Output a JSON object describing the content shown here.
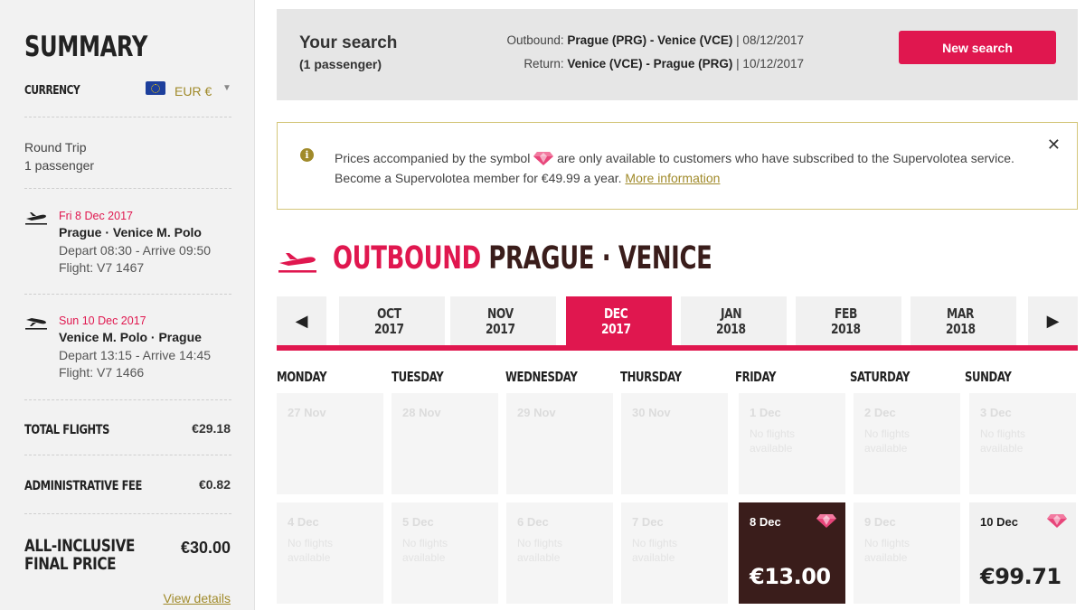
{
  "sidebar": {
    "title": "SUMMARY",
    "currency_label": "CURRENCY",
    "currency_value": "EUR €",
    "trip_type": "Round Trip",
    "passengers": "1 passenger",
    "flights": [
      {
        "date": "Fri 8 Dec 2017",
        "route": "Prague · Venice M. Polo",
        "times": "Depart 08:30 - Arrive 09:50",
        "flight": "Flight: V7 1467"
      },
      {
        "date": "Sun 10 Dec 2017",
        "route": "Venice M. Polo · Prague",
        "times": "Depart 13:15 - Arrive 14:45",
        "flight": "Flight: V7 1466"
      }
    ],
    "total_flights_label": "TOTAL FLIGHTS",
    "total_flights_value": "€29.18",
    "admin_fee_label": "ADMINISTRATIVE FEE",
    "admin_fee_value": "€0.82",
    "final_label_1": "ALL-INCLUSIVE",
    "final_label_2": "FINAL PRICE",
    "final_value": "€30.00",
    "view_details": "View details"
  },
  "search": {
    "title": "Your search",
    "passengers": "(1 passenger)",
    "outbound_label": "Outbound:",
    "outbound_route": "Prague (PRG) - Venice (VCE)",
    "outbound_date": "| 08/12/2017",
    "return_label": "Return:",
    "return_route": "Venice (VCE) - Prague (PRG)",
    "return_date": "| 10/12/2017",
    "new_search": "New search"
  },
  "notice": {
    "text_before": "Prices accompanied by the symbol",
    "text_after": "are only available to customers who have subscribed to the Supervolotea service. Become a Supervolotea member for €49.99 a year.",
    "link": "More information",
    "close": "✕"
  },
  "outbound": {
    "word": "OUTBOUND",
    "route": "PRAGUE · VENICE"
  },
  "months": [
    {
      "month": "OCT",
      "year": "2017"
    },
    {
      "month": "NOV",
      "year": "2017"
    },
    {
      "month": "DEC",
      "year": "2017"
    },
    {
      "month": "JAN",
      "year": "2018"
    },
    {
      "month": "FEB",
      "year": "2018"
    },
    {
      "month": "MAR",
      "year": "2018"
    }
  ],
  "active_month": "DEC",
  "weekdays": [
    "MONDAY",
    "TUESDAY",
    "WEDNESDAY",
    "THURSDAY",
    "FRIDAY",
    "SATURDAY",
    "SUNDAY"
  ],
  "no_flights": "No flights available",
  "calendar": [
    [
      {
        "day": "27 Nov"
      },
      {
        "day": "28 Nov"
      },
      {
        "day": "29 Nov"
      },
      {
        "day": "30 Nov"
      },
      {
        "day": "1 Dec",
        "note": "No flights available"
      },
      {
        "day": "2 Dec",
        "note": "No flights available"
      },
      {
        "day": "3 Dec",
        "note": "No flights available"
      }
    ],
    [
      {
        "day": "4 Dec",
        "note": "No flights available"
      },
      {
        "day": "5 Dec",
        "note": "No flights available"
      },
      {
        "day": "6 Dec",
        "note": "No flights available"
      },
      {
        "day": "7 Dec",
        "note": "No flights available"
      },
      {
        "day": "8 Dec",
        "price": "€13.00",
        "selected": true,
        "supervolotea": true
      },
      {
        "day": "9 Dec",
        "note": "No flights available"
      },
      {
        "day": "10 Dec",
        "price": "€99.71",
        "supervolotea": true
      }
    ]
  ],
  "colors": {
    "brand": "#e0174f",
    "dark": "#3a1d1b",
    "gold": "#a08a2a"
  }
}
